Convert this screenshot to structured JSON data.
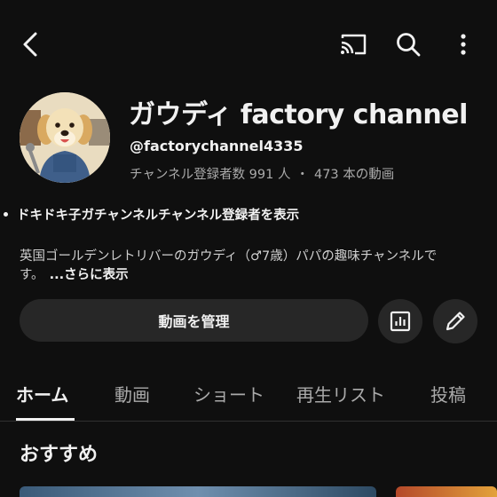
{
  "channel": {
    "name": "ガウディ factory channel",
    "handle": "@factorychannel4335",
    "subscribers": "チャンネル登録者数 991 人",
    "separator": "・",
    "videos": "473 本の動画",
    "subscriber_link": "ドキドキ子ガチャンネルチャンネル登録者を表示",
    "description": "英国ゴールデンレトリバーのガウディ（♂7歳）パパの趣味チャンネルです。",
    "more_label": "...さらに表示"
  },
  "actions": {
    "manage_label": "動画を管理"
  },
  "tabs": [
    {
      "label": "ホーム",
      "active": true
    },
    {
      "label": "動画",
      "active": false
    },
    {
      "label": "ショート",
      "active": false
    },
    {
      "label": "再生リスト",
      "active": false
    },
    {
      "label": "投稿",
      "active": false
    }
  ],
  "section": {
    "title": "おすすめ"
  },
  "icons": {
    "back": "back-arrow-icon",
    "cast": "cast-icon",
    "search": "search-icon",
    "more": "more-vertical-icon",
    "analytics": "analytics-icon",
    "edit": "pencil-icon"
  },
  "colors": {
    "background": "#0f0f0f",
    "surface": "#272727",
    "text_primary": "#f1f1f1",
    "text_secondary": "#aaaaaa"
  }
}
